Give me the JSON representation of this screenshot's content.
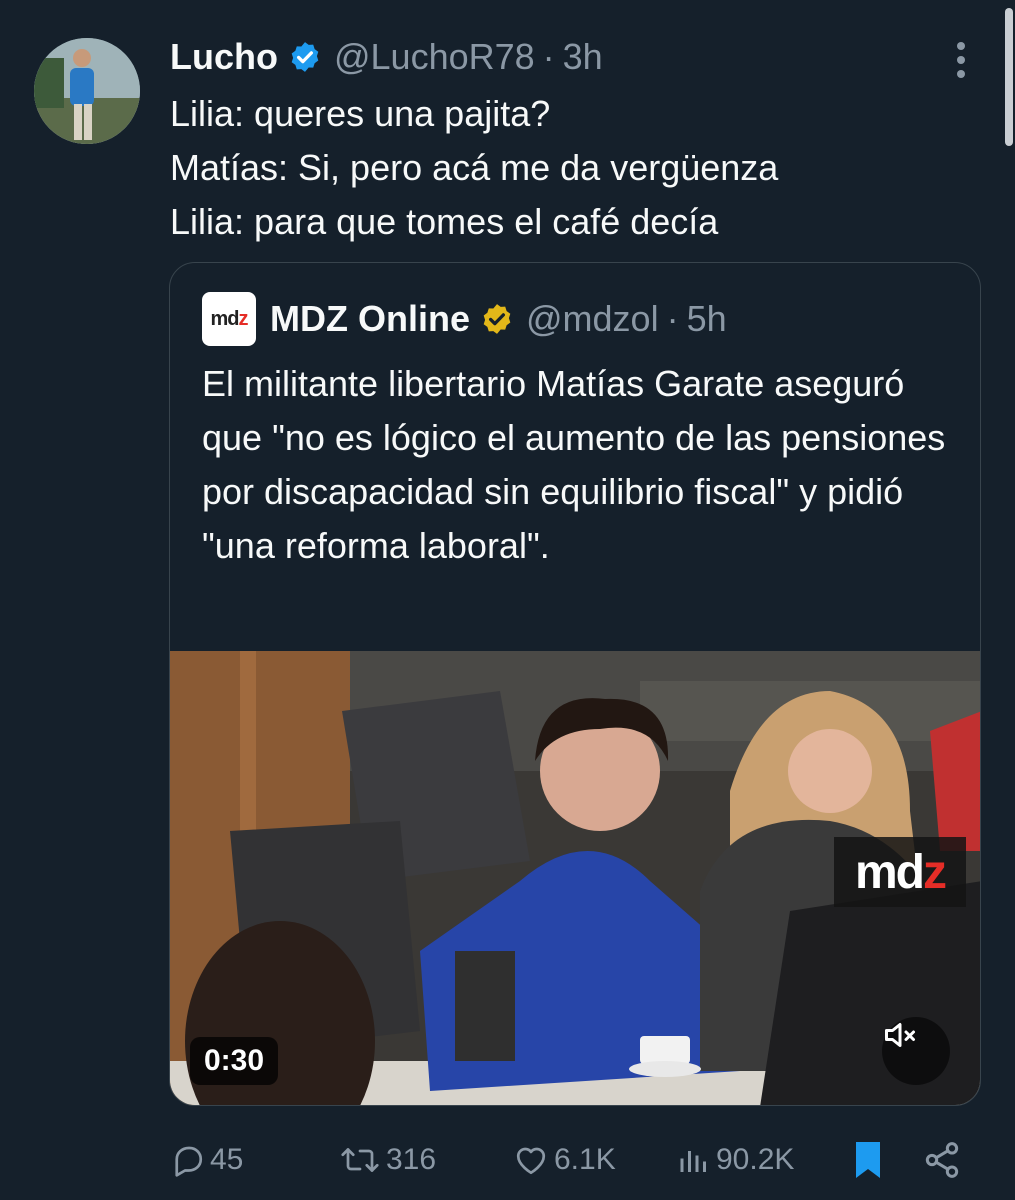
{
  "tweet": {
    "author": {
      "name": "Lucho",
      "handle": "@LuchoR78",
      "separator": "·",
      "time": "3h"
    },
    "lines": [
      "Lilia: queres una pajita?",
      "Matías: Si, pero acá me da vergüenza",
      "Lilia: para que tomes el café decía"
    ]
  },
  "quote": {
    "logo_text_a": "md",
    "logo_text_b": "z",
    "author": {
      "name": "MDZ Online",
      "handle": "@mdzol",
      "separator": "·",
      "time": "5h"
    },
    "text": "El militante libertario Matías Garate aseguró que \"no es lógico el aumento de las pensiones por discapacidad sin equilibrio fiscal\" y pidió \"una reforma laboral\".",
    "video": {
      "duration": "0:30",
      "watermark_a": "md",
      "watermark_b": "z"
    }
  },
  "actions": {
    "replies": "45",
    "retweets": "316",
    "likes": "6.1K",
    "views": "90.2K"
  },
  "icons": [
    "verified-badge-icon",
    "gold-verified-badge-icon",
    "more-icon",
    "mute-icon",
    "reply-icon",
    "retweet-icon",
    "like-icon",
    "views-icon",
    "bookmark-icon",
    "share-icon"
  ],
  "colors": {
    "background": "#15202b",
    "text": "#f7f9f9",
    "secondary": "#8b98a5",
    "accent": "#1d9bf0",
    "gold": "#e2b719",
    "mdz_red": "#e52d27"
  }
}
